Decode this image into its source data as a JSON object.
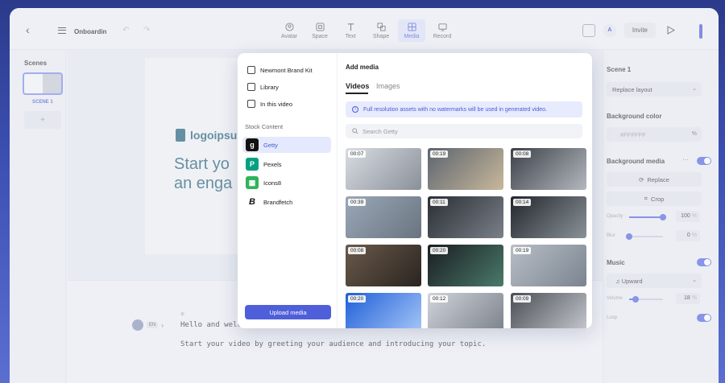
{
  "topbar": {
    "doc_title": "Onboardin",
    "tools": [
      {
        "label": "Avatar",
        "icon": "avatar-icon",
        "active": false
      },
      {
        "label": "Space",
        "icon": "space-icon",
        "active": false
      },
      {
        "label": "Text",
        "icon": "text-icon",
        "active": false
      },
      {
        "label": "Shape",
        "icon": "shape-icon",
        "active": false
      },
      {
        "label": "Media",
        "icon": "media-icon",
        "active": true
      },
      {
        "label": "Record",
        "icon": "record-icon",
        "active": false
      }
    ],
    "avatar_initial": "A",
    "invite_label": "Invite"
  },
  "scenes": {
    "title": "Scenes",
    "scene_label": "SCENE 1",
    "add_label": "+"
  },
  "slide": {
    "logo_text": "logoipsu",
    "heading_line1": "Start yo",
    "heading_line2": "an enga"
  },
  "script": {
    "lang": "EN",
    "line1": "Hello and welcome to this office update template.",
    "line2": "Start your video by greeting your audience and introducing your topic."
  },
  "right_panel": {
    "scene_title": "Scene 1",
    "replace_layout": "Replace layout",
    "bg_color_title": "Background color",
    "bg_color_value": "#FFFFFF",
    "bg_color_unit": "%",
    "bg_media_title": "Background media",
    "replace_label": "Replace",
    "crop_label": "Crop",
    "opacity_label": "Opacity",
    "opacity_value": "100",
    "opacity_unit": "%",
    "opacity_level": 1.0,
    "blur_label": "Blur",
    "blur_value": "0",
    "blur_unit": "%",
    "blur_level": 0.0,
    "music_title": "Music",
    "music_track": "Upward",
    "volume_label": "Volume",
    "volume_value": "18",
    "volume_unit": "%",
    "volume_level": 0.18,
    "loop_label": "Loop"
  },
  "media_popover": {
    "left_items": [
      {
        "label": "Newmont Brand Kit",
        "icon": "brand-kit-icon"
      },
      {
        "label": "Library",
        "icon": "library-icon"
      },
      {
        "label": "In this video",
        "icon": "calendar-icon"
      }
    ],
    "stock_title": "Stock Content",
    "sources": [
      {
        "label": "Getty",
        "logo": "g",
        "color": "#111111",
        "active": true
      },
      {
        "label": "Pexels",
        "logo": "P",
        "color": "#05a081",
        "active": false
      },
      {
        "label": "Icons8",
        "logo": "▦",
        "color": "#30b35b",
        "active": false
      },
      {
        "label": "Brandfetch",
        "logo": "B",
        "color": "#ffffff",
        "active": false
      }
    ],
    "upload_label": "Upload media",
    "title": "Add media",
    "tabs": [
      "Videos",
      "Images"
    ],
    "info": "Full resolution assets with no watermarks will be used in generated video.",
    "search_placeholder": "Search Getty",
    "videos": [
      {
        "duration": "00:07",
        "colors": [
          "#d9dde3",
          "#8a9099"
        ]
      },
      {
        "duration": "00:19",
        "colors": [
          "#5c6470",
          "#c8b89a"
        ]
      },
      {
        "duration": "00:08",
        "colors": [
          "#3c4048",
          "#b4b8be"
        ]
      },
      {
        "duration": "00:39",
        "colors": [
          "#9aa8b8",
          "#6a7480"
        ]
      },
      {
        "duration": "00:11",
        "colors": [
          "#2a2e34",
          "#7a8088"
        ]
      },
      {
        "duration": "00:14",
        "colors": [
          "#22262c",
          "#8a9298"
        ]
      },
      {
        "duration": "00:08",
        "colors": [
          "#6a5a4a",
          "#2a2420"
        ]
      },
      {
        "duration": "00:20",
        "colors": [
          "#1a1c20",
          "#4a7a6a"
        ]
      },
      {
        "duration": "00:19",
        "colors": [
          "#b8bec6",
          "#7a8490"
        ]
      },
      {
        "duration": "00:20",
        "colors": [
          "#1f5fd8",
          "#a8c8f8"
        ]
      },
      {
        "duration": "00:12",
        "colors": [
          "#d0d4da",
          "#7a808a"
        ]
      },
      {
        "duration": "00:09",
        "colors": [
          "#4a4e54",
          "#c8ccd2"
        ]
      }
    ]
  }
}
